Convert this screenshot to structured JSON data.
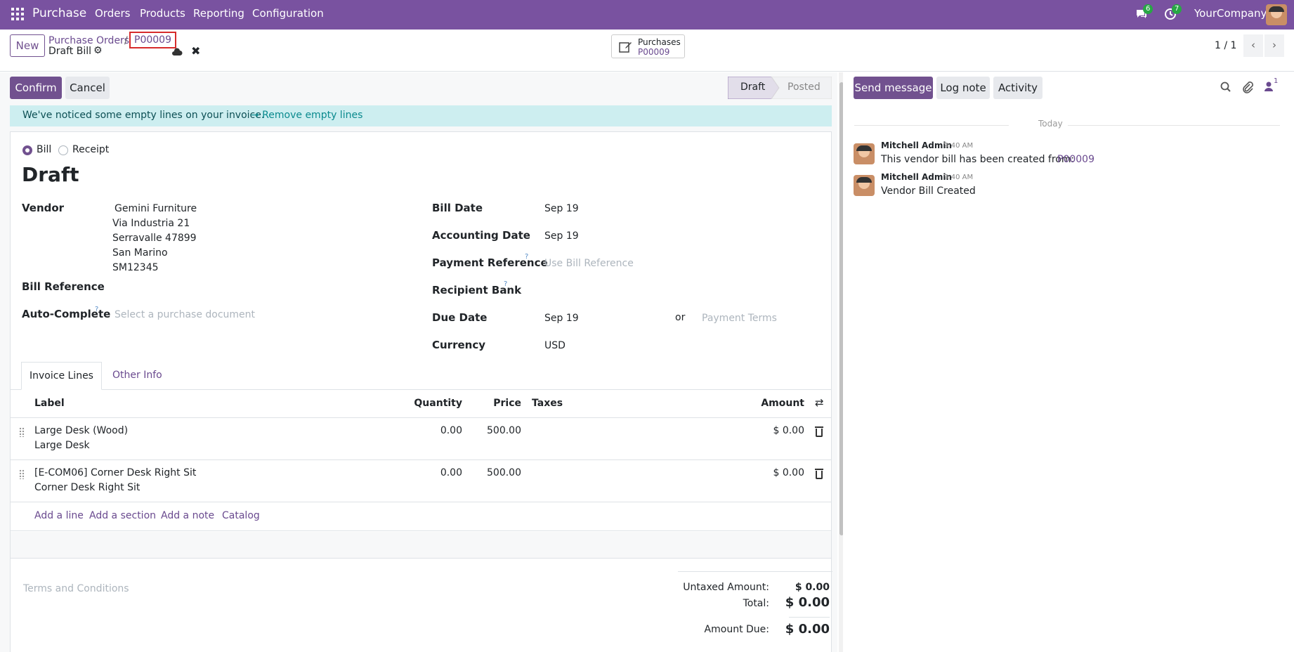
{
  "topnav": {
    "app": "Purchase",
    "menu": [
      "Orders",
      "Products",
      "Reporting",
      "Configuration"
    ],
    "messages_count": "6",
    "activities_count": "7",
    "company": "YourCompany"
  },
  "control": {
    "new_label": "New",
    "breadcrumb_parent": "Purchase Orders",
    "breadcrumb_sep": "/",
    "breadcrumb_current": "P00009",
    "record_title": "Draft Bill",
    "smart_button_label": "Purchases",
    "smart_button_value": "P00009",
    "pager": "1 / 1"
  },
  "actions": {
    "confirm": "Confirm",
    "cancel": "Cancel",
    "status": [
      "Draft",
      "Posted"
    ]
  },
  "alert": {
    "text": "We've noticed some empty lines on your invoice.",
    "link": "→ Remove empty lines"
  },
  "form": {
    "type_options": [
      "Bill",
      "Receipt"
    ],
    "title": "Draft",
    "vendor_label": "Vendor",
    "vendor_name": "Gemini Furniture",
    "vendor_address": [
      "Via Industria 21",
      "Serravalle 47899",
      "San Marino",
      "SM12345"
    ],
    "bill_reference_label": "Bill Reference",
    "auto_complete_label": "Auto-Complete",
    "auto_complete_placeholder": "Select a purchase document",
    "bill_date_label": "Bill Date",
    "bill_date": "Sep 19",
    "accounting_date_label": "Accounting Date",
    "accounting_date": "Sep 19",
    "payment_ref_label": "Payment Reference",
    "payment_ref_placeholder": "Use Bill Reference",
    "recipient_bank_label": "Recipient Bank",
    "due_date_label": "Due Date",
    "due_date": "Sep 19",
    "or": "or",
    "payment_terms_placeholder": "Payment Terms",
    "currency_label": "Currency",
    "currency": "USD",
    "help_mark": "?"
  },
  "tabs": [
    "Invoice Lines",
    "Other Info"
  ],
  "table": {
    "headers": {
      "label": "Label",
      "quantity": "Quantity",
      "price": "Price",
      "taxes": "Taxes",
      "amount": "Amount"
    },
    "rows": [
      {
        "name": "Large Desk (Wood)",
        "desc": "Large Desk",
        "quantity": "0.00",
        "price": "500.00",
        "amount": "$ 0.00"
      },
      {
        "name": "[E-COM06] Corner Desk Right Sit",
        "desc": "Corner Desk Right Sit",
        "quantity": "0.00",
        "price": "500.00",
        "amount": "$ 0.00"
      }
    ],
    "add_links": [
      "Add a line",
      "Add a section",
      "Add a note",
      "Catalog"
    ]
  },
  "totals": {
    "terms_placeholder": "Terms and Conditions",
    "untaxed_label": "Untaxed Amount:",
    "untaxed": "$ 0.00",
    "total_label": "Total:",
    "total": "$ 0.00",
    "amount_due_label": "Amount Due:",
    "amount_due": "$ 0.00"
  },
  "chatter": {
    "send_message": "Send message",
    "log_note": "Log note",
    "activity": "Activity",
    "followers_count": "1",
    "date_separator": "Today",
    "messages": [
      {
        "author": "Mitchell Admin",
        "time": "9:40 AM",
        "body": "This vendor bill has been created from:",
        "link": "P00009"
      },
      {
        "author": "Mitchell Admin",
        "time": "9:40 AM",
        "body": "Vendor Bill Created",
        "link": ""
      }
    ]
  }
}
